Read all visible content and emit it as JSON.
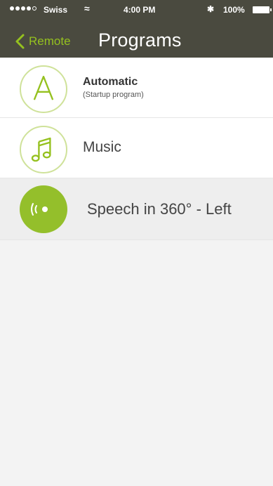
{
  "status_bar": {
    "carrier": "Swiss",
    "time": "4:00 PM",
    "battery": "100%"
  },
  "nav": {
    "back_label": "Remote",
    "title": "Programs"
  },
  "programs": [
    {
      "title": "Automatic",
      "subtitle": "(Startup program)",
      "icon": "letter-a-icon",
      "selected": false
    },
    {
      "title": "Music",
      "icon": "music-note-icon",
      "selected": false
    },
    {
      "title": "Speech in 360° - Left",
      "icon": "speech-360-icon",
      "selected": true
    }
  ],
  "colors": {
    "accent": "#95c11f",
    "header": "#4a4a3f",
    "icon_border": "#cfe29a",
    "selected_icon_fill": "#94bf2b"
  }
}
